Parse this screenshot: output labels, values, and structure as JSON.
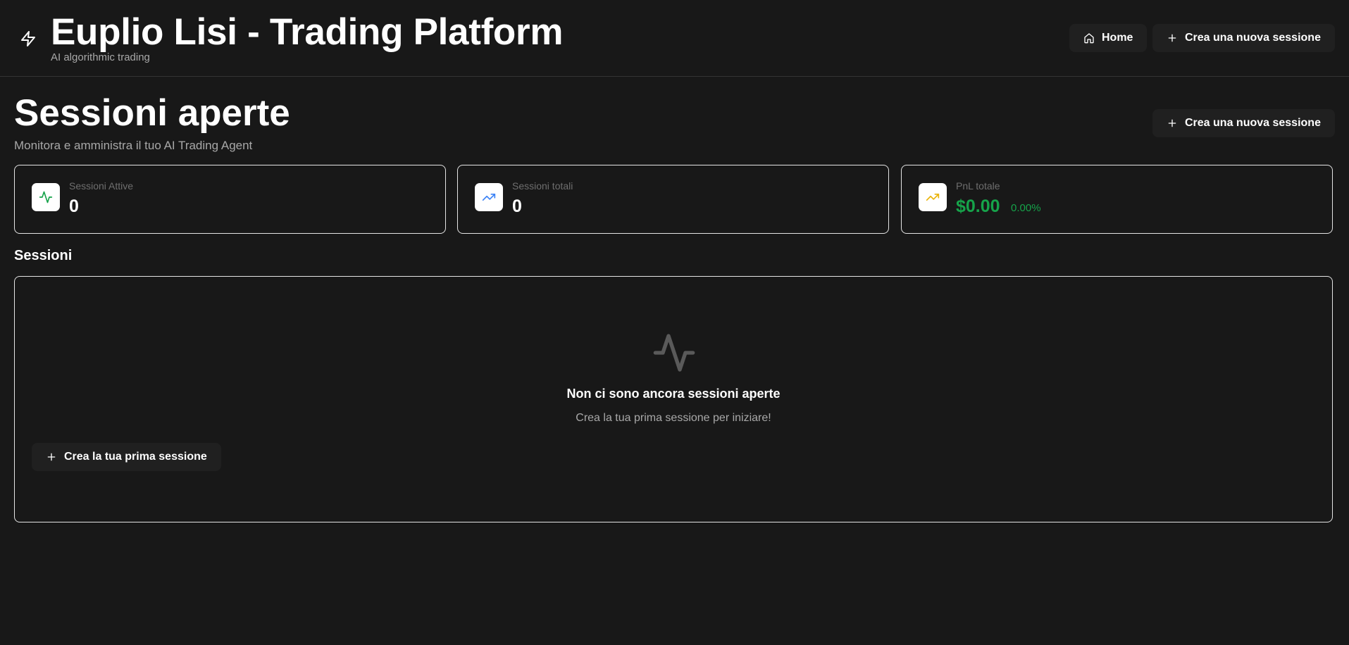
{
  "header": {
    "title": "Euplio Lisi - Trading Platform",
    "subtitle": "AI algorithmic trading",
    "logo_icon": "zap-icon",
    "home_label": "Home",
    "new_session_label": "Crea una nuova sessione"
  },
  "page": {
    "title": "Sessioni aperte",
    "subtitle": "Monitora e amministra il tuo AI Trading Agent",
    "new_session_label": "Crea una nuova sessione"
  },
  "stats": [
    {
      "label": "Sessioni Attive",
      "value": "0",
      "icon": "activity-icon",
      "color": "#16a34a"
    },
    {
      "label": "Sessioni totali",
      "value": "0",
      "icon": "trending-up-icon",
      "color": "#3b82f6"
    },
    {
      "label": "PnL totale",
      "value": "$0.00",
      "percent": "0.00%",
      "icon": "trending-up-icon",
      "color": "#eab308"
    }
  ],
  "sessions": {
    "section_title": "Sessioni",
    "empty_title": "Non ci sono ancora sessioni aperte",
    "empty_subtitle": "Crea la tua prima sessione per iniziare!",
    "create_first_label": "Crea la tua prima sessione",
    "empty_icon": "activity-icon"
  },
  "colors": {
    "background": "#181818",
    "button_bg": "#202020",
    "positive": "#16a34a"
  }
}
